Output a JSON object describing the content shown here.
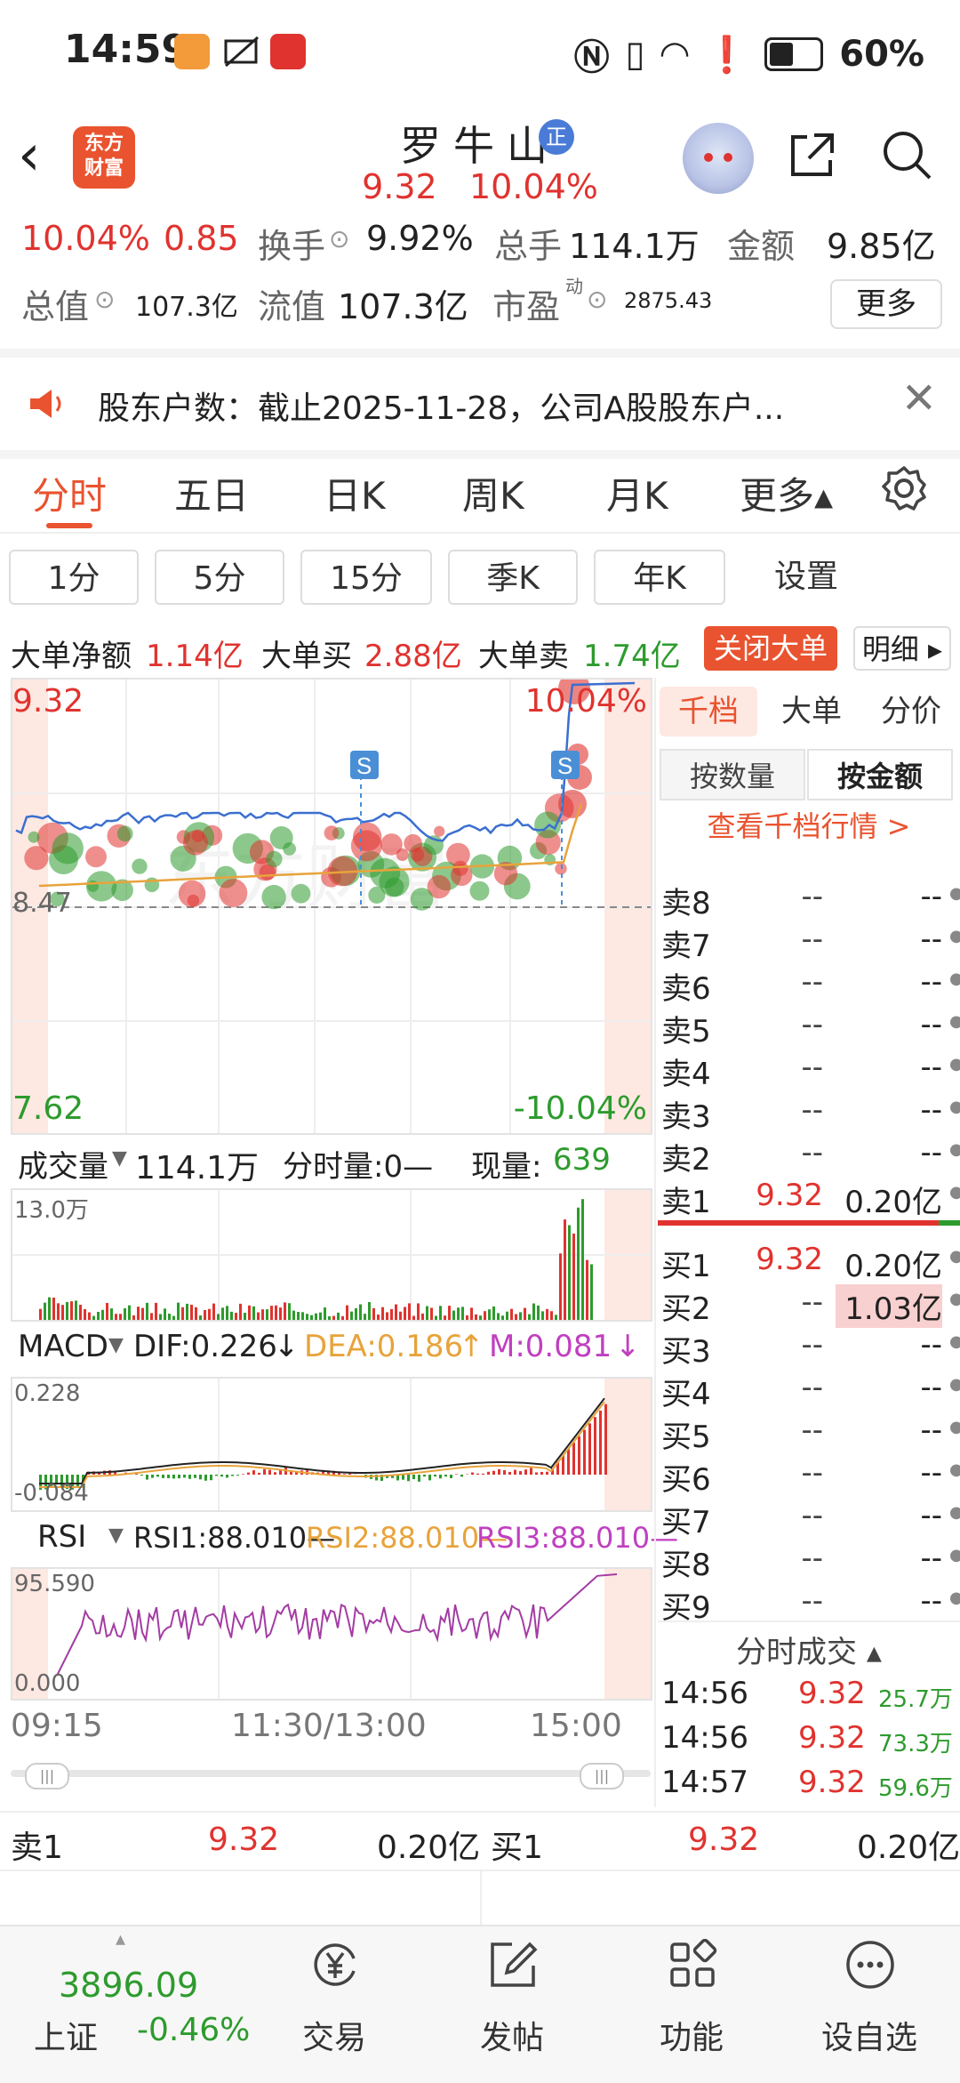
{
  "status_bar": {
    "time": "14:59",
    "battery": "60%"
  },
  "header": {
    "logo_line1": "东方",
    "logo_line2": "财富",
    "stock_name": "罗牛山",
    "badge": "正",
    "price": "9.32",
    "change_pct": "10.04%"
  },
  "quote": {
    "row1": {
      "pct": "10.04%",
      "change": "0.85",
      "turnover_label": "换手",
      "turnover": "9.92%",
      "volume_label": "总手",
      "volume": "114.1万",
      "amount_label": "金额",
      "amount": "9.85亿"
    },
    "row2": {
      "mktcap_label": "总值",
      "mktcap": "107.3亿",
      "float_label": "流值",
      "float": "107.3亿",
      "pe_label": "市盈",
      "pe_sup": "动",
      "pe": "2875.43",
      "more": "更多"
    }
  },
  "notice": {
    "text": "股东户数：截止2025-11-28，公司A股股东户..."
  },
  "period_tabs": [
    "分时",
    "五日",
    "日K",
    "周K",
    "月K",
    "更多▴"
  ],
  "minute_buttons": [
    "1分",
    "5分",
    "15分",
    "季K",
    "年K",
    "设置"
  ],
  "big_order": {
    "net_label": "大单净额",
    "net": "1.14亿",
    "buy_label": "大单买",
    "buy": "2.88亿",
    "sell_label": "大单卖",
    "sell": "1.74亿",
    "close_btn": "关闭大单",
    "detail_btn": "明细 ▸"
  },
  "price_chart": {
    "high": "9.32",
    "high_pct": "10.04%",
    "low": "7.62",
    "low_pct": "-10.04%",
    "mid_label": "8.47",
    "s_marker": "S",
    "watermark": "东方财富"
  },
  "volume_panel": {
    "label": "成交量",
    "total": "114.1万",
    "minute_label": "分时量:0—",
    "now_label": "现量:",
    "now": "639",
    "axis_top": "13.0万"
  },
  "macd_panel": {
    "label": "MACD",
    "dif": "DIF:0.226",
    "dea": "DEA:0.186",
    "m": "M:0.081",
    "axis_top": "0.228",
    "axis_bottom": "-0.084"
  },
  "rsi_panel": {
    "label": "RSI",
    "rsi1": "RSI1:88.010—",
    "rsi2": "RSI2:88.010—",
    "rsi3": "RSI3:88.010—",
    "axis_top": "95.590",
    "axis_bottom": "0.000"
  },
  "time_axis": [
    "09:15",
    "11:30/13:00",
    "15:00"
  ],
  "order_book": {
    "tabs": [
      "千档",
      "大单",
      "分价"
    ],
    "sub_tabs": [
      "按数量",
      "按金额"
    ],
    "link": "查看千档行情 >",
    "sells": [
      {
        "label": "卖8",
        "price": "--",
        "amount": "--"
      },
      {
        "label": "卖7",
        "price": "--",
        "amount": "--"
      },
      {
        "label": "卖6",
        "price": "--",
        "amount": "--"
      },
      {
        "label": "卖5",
        "price": "--",
        "amount": "--"
      },
      {
        "label": "卖4",
        "price": "--",
        "amount": "--"
      },
      {
        "label": "卖3",
        "price": "--",
        "amount": "--"
      },
      {
        "label": "卖2",
        "price": "--",
        "amount": "--"
      },
      {
        "label": "卖1",
        "price": "9.32",
        "amount": "0.20亿"
      }
    ],
    "buys": [
      {
        "label": "买1",
        "price": "9.32",
        "amount": "0.20亿"
      },
      {
        "label": "买2",
        "price": "--",
        "amount": "1.03亿"
      },
      {
        "label": "买3",
        "price": "--",
        "amount": "--"
      },
      {
        "label": "买4",
        "price": "--",
        "amount": "--"
      },
      {
        "label": "买5",
        "price": "--",
        "amount": "--"
      },
      {
        "label": "买6",
        "price": "--",
        "amount": "--"
      },
      {
        "label": "买7",
        "price": "--",
        "amount": "--"
      },
      {
        "label": "买8",
        "price": "--",
        "amount": "--"
      },
      {
        "label": "买9",
        "price": "--",
        "amount": "--"
      }
    ],
    "trades_title": "分时成交 ▴",
    "trades": [
      {
        "time": "14:56",
        "price": "9.32",
        "amount": "25.7万"
      },
      {
        "time": "14:56",
        "price": "9.32",
        "amount": "73.3万"
      },
      {
        "time": "14:57",
        "price": "9.32",
        "amount": "59.6万"
      }
    ]
  },
  "bottom_quote": {
    "left_label": "卖1",
    "left_price": "9.32",
    "left_amount": "0.20亿",
    "right_label": "买1",
    "right_price": "9.32",
    "right_amount": "0.20亿"
  },
  "index": {
    "value": "3896.09",
    "name": "上证",
    "pct": "-0.46%"
  },
  "nav": [
    "交易",
    "发帖",
    "功能",
    "设自选"
  ],
  "colors": {
    "up": "#e0332f",
    "down": "#2d9b2d",
    "brand": "#e9532f",
    "avg_line": "#e8a33b",
    "price_line": "#3b6fcf"
  }
}
